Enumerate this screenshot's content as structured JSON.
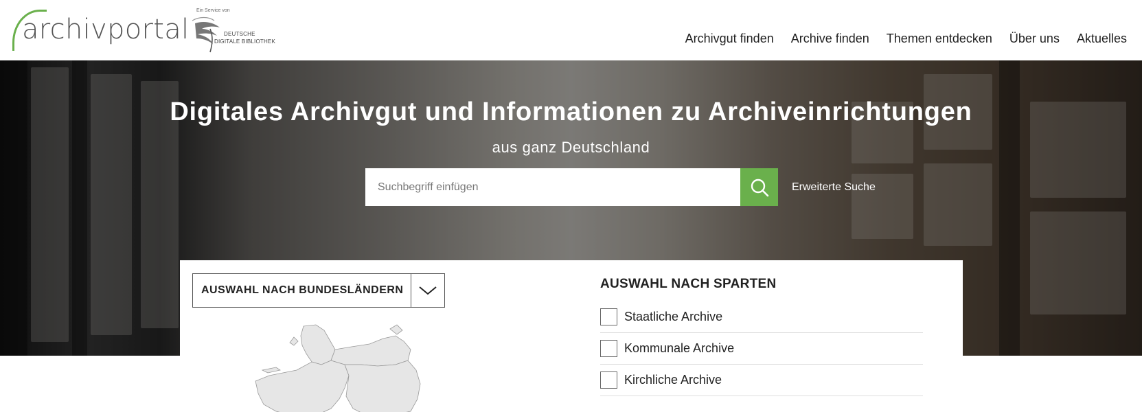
{
  "header": {
    "logo_text": "archivportal",
    "ddb": {
      "service_text": "Ein Service von",
      "name_line1": "DEUTSCHE",
      "name_line2": "DIGITALE BIBLIOTHEK"
    },
    "nav": [
      {
        "label": "Archivgut finden"
      },
      {
        "label": "Archive finden"
      },
      {
        "label": "Themen entdecken"
      },
      {
        "label": "Über uns"
      },
      {
        "label": "Aktuelles"
      }
    ]
  },
  "hero": {
    "title": "Digitales Archivgut und Informationen zu Archiveinrichtungen",
    "subtitle": "aus ganz Deutschland",
    "search": {
      "placeholder": "Suchbegriff einfügen",
      "value": "",
      "button_icon": "search-icon",
      "advanced_label": "Erweiterte Suche"
    }
  },
  "colors": {
    "accent": "#6ab04c",
    "text": "#222222"
  },
  "bundeslaender": {
    "select_label": "AUSWAHL NACH BUNDESLÄNDERN",
    "arrow_icon": "chevron-down-icon"
  },
  "sparten": {
    "title": "AUSWAHL NACH SPARTEN",
    "items": [
      {
        "label": "Staatliche Archive",
        "checked": false
      },
      {
        "label": "Kommunale Archive",
        "checked": false
      },
      {
        "label": "Kirchliche Archive",
        "checked": false
      }
    ]
  }
}
